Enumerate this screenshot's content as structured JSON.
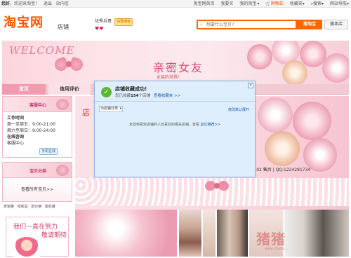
{
  "topbar": {
    "greeting": "您好，欢迎来淘宝！",
    "user": "您好",
    "logout": "退出",
    "messages": "站内信",
    "my_taobao": "淘宝网首页",
    "buy": "我要买",
    "my_taobao_menu": "我的淘宝",
    "cart": "购物车",
    "favorites": "收藏夹",
    "search": "搜索",
    "sitemap": "网站导航"
  },
  "header": {
    "logo": "淘宝网",
    "logo_sub": "店铺",
    "seller_name": "优秀兵哥",
    "seller_badge": "仙营城信",
    "hearts": "♥♥",
    "search_placeholder": "想要什么宝贝?",
    "search_taobao": "搜淘宝",
    "search_shop": "搜本店"
  },
  "banner": {
    "welcome": "WELCOME",
    "title": "亲密女友",
    "subtitle": "女装的世界！"
  },
  "nav": {
    "home": "首页",
    "reviews": "信用评价"
  },
  "sidebar": {
    "service_title": "客服中心",
    "hours_title": "工作时间",
    "hours_1": "周一至周五：9:00-21:00",
    "hours_2": "周六至周日：9:00-24:00",
    "online_title": "在线咨询",
    "online_label": "客服中心",
    "online_badge": "手机在线",
    "category_title": "宝贝分类",
    "all_link": "查看所有宝贝>>",
    "categories": [
      "按销量",
      "按新品",
      "按价格",
      "按收藏"
    ],
    "ad_line1": "我们一直在努力",
    "ad_line2": "敬请期待"
  },
  "main": {
    "store_char": "店",
    "contact": "QQ:245355102 售后 | QQ:1224281734",
    "watermark": "猪猪",
    "watermark_url": "www.zhuba..."
  },
  "popup": {
    "title": "店铺收藏成功！",
    "sub_prefix": "您已收藏",
    "count": "154",
    "sub_suffix": "个店铺",
    "view_link": "查看收藏夹 >>",
    "select": "为店铺分类",
    "current": "修改默认展开",
    "empty_text": "未找到喜欢店铺的人还喜欢的相关店铺，查看",
    "empty_link": "其它推荐>>",
    "close": "x"
  }
}
